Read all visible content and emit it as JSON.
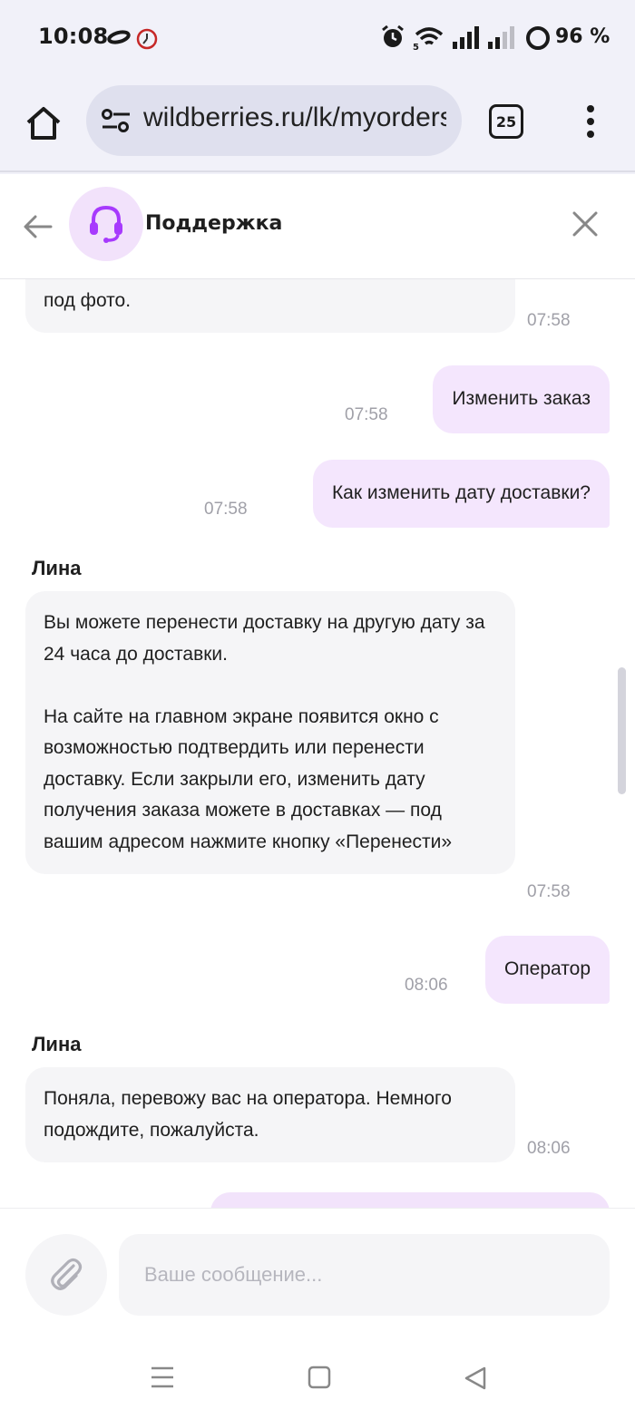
{
  "status_bar": {
    "time": "10:08",
    "battery_text": "96 %",
    "icons": [
      "infinity-icon",
      "clock-badge-icon",
      "alarm-icon",
      "wifi-icon",
      "signal-icon",
      "signal-weak-icon",
      "battery-ring-icon"
    ]
  },
  "browser": {
    "url": "wildberries.ru/lk/myorders",
    "tab_count": "25",
    "icons": [
      "home-icon",
      "tune-icon",
      "overflow-menu-icon"
    ]
  },
  "chat_header": {
    "title": "Поддержка",
    "icons": [
      "back-arrow-icon",
      "headset-icon",
      "close-icon"
    ]
  },
  "messages": [
    {
      "from": "bot",
      "text": "числа нужно забрать покупку, нажмите на статус под фото.",
      "time": "07:58"
    },
    {
      "from": "user",
      "text": "Изменить заказ",
      "time": "07:58"
    },
    {
      "from": "user",
      "text": "Как изменить дату доставки?",
      "time": "07:58"
    },
    {
      "from": "bot",
      "sender": "Лина",
      "text": "Вы можете перенести доставку на другую дату за 24 часа до доставки.\n\nНа сайте на главном экране появится окно с возможностью подтвердить или перенести доставку. Если закрыли его, изменить дату получения заказа можете в доставках — под вашим адресом нажмите кнопку «Перенести»",
      "time": "07:58"
    },
    {
      "from": "user",
      "text": "Оператор",
      "time": "08:06"
    },
    {
      "from": "bot",
      "sender": "Лина",
      "text": "Поняла, перевожу вас на оператора. Немного подождите, пожалуйста.",
      "time": "08:06"
    }
  ],
  "composer": {
    "placeholder": "Ваше сообщение...",
    "icons": [
      "paperclip-icon"
    ]
  },
  "nav_bar": {
    "icons": [
      "recent-apps-icon",
      "home-square-icon",
      "back-triangle-icon"
    ]
  },
  "colors": {
    "accent": "#a73afd",
    "user_bubble": "#f4e6fd",
    "bot_bubble": "#f5f5f7",
    "time_text": "#a0a0a8"
  }
}
